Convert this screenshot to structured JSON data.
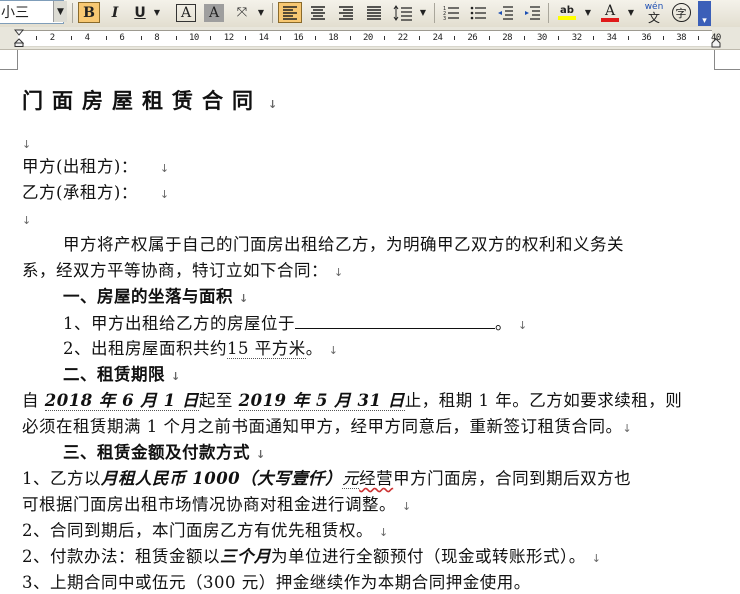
{
  "toolbar": {
    "font_size": "小三",
    "bold": "B",
    "italic": "I",
    "underline": "U",
    "char_border": "A",
    "char_shading": "A",
    "scale": "A",
    "highlight": "ab",
    "font_color": "A",
    "phonetic_top": "wén",
    "phonetic_bottom": "文",
    "enclose": "字"
  },
  "ruler": {
    "labels": [
      "2",
      "4",
      "6",
      "8",
      "10",
      "12",
      "14",
      "16",
      "18",
      "20",
      "22",
      "24",
      "26",
      "28",
      "30",
      "32",
      "34",
      "36",
      "38",
      "40"
    ]
  },
  "document": {
    "title": "门面房屋租赁合同",
    "lessor_label": "甲方(出租方)：",
    "lessee_label": "乙方(承租方)：",
    "intro_1": "甲方将产权属于自己的门面房出租给乙方，为明确甲乙双方的权利和义务关",
    "intro_2": "系，经双方平等协商，特订立如下合同：",
    "s1_heading": "一、房屋的坐落与面积",
    "s1_item1_a": "1、甲方出租给乙方的房屋位于",
    "s1_item1_b": "。",
    "s1_item2_a": "2、出租房屋面积共约",
    "s1_item2_b": "15 平方米",
    "s1_item2_c": "。",
    "s2_heading": "二、租赁期限",
    "s2_a": "自",
    "s2_start": "2018 年 6 月 1 日",
    "s2_b": "起至",
    "s2_end": "2019 年 5 月 31 日",
    "s2_c": "止，租期 1 年。乙方如要求续租，则",
    "s2_line2": "必须在租赁期满 1 个月之前书面通知甲方，经甲方同意后，重新签订租赁合同。",
    "s3_heading": "三、租赁金额及付款方式",
    "s3_1a": "1、乙方以",
    "s3_1b": "月租人民币 1000（大写壹仟）",
    "s3_1c": "元",
    "s3_1d": "经营",
    "s3_1e": "甲方门面房，合同到期后双方也",
    "s3_1_line2": "可根据门面房出租市场情况协商对租金进行调整。",
    "s3_2": "2、合同到期后，本门面房乙方有优先租赁权。",
    "s3_3a": "2、付款办法：租赁金额以",
    "s3_3b": "三个月",
    "s3_3c": "为单位进行全额预付（现金或转账形式）。",
    "s3_4": "3、上期合同中或伍元（300 元）押金继续作为本期合同押金使用。",
    "para_mark": "↓"
  }
}
